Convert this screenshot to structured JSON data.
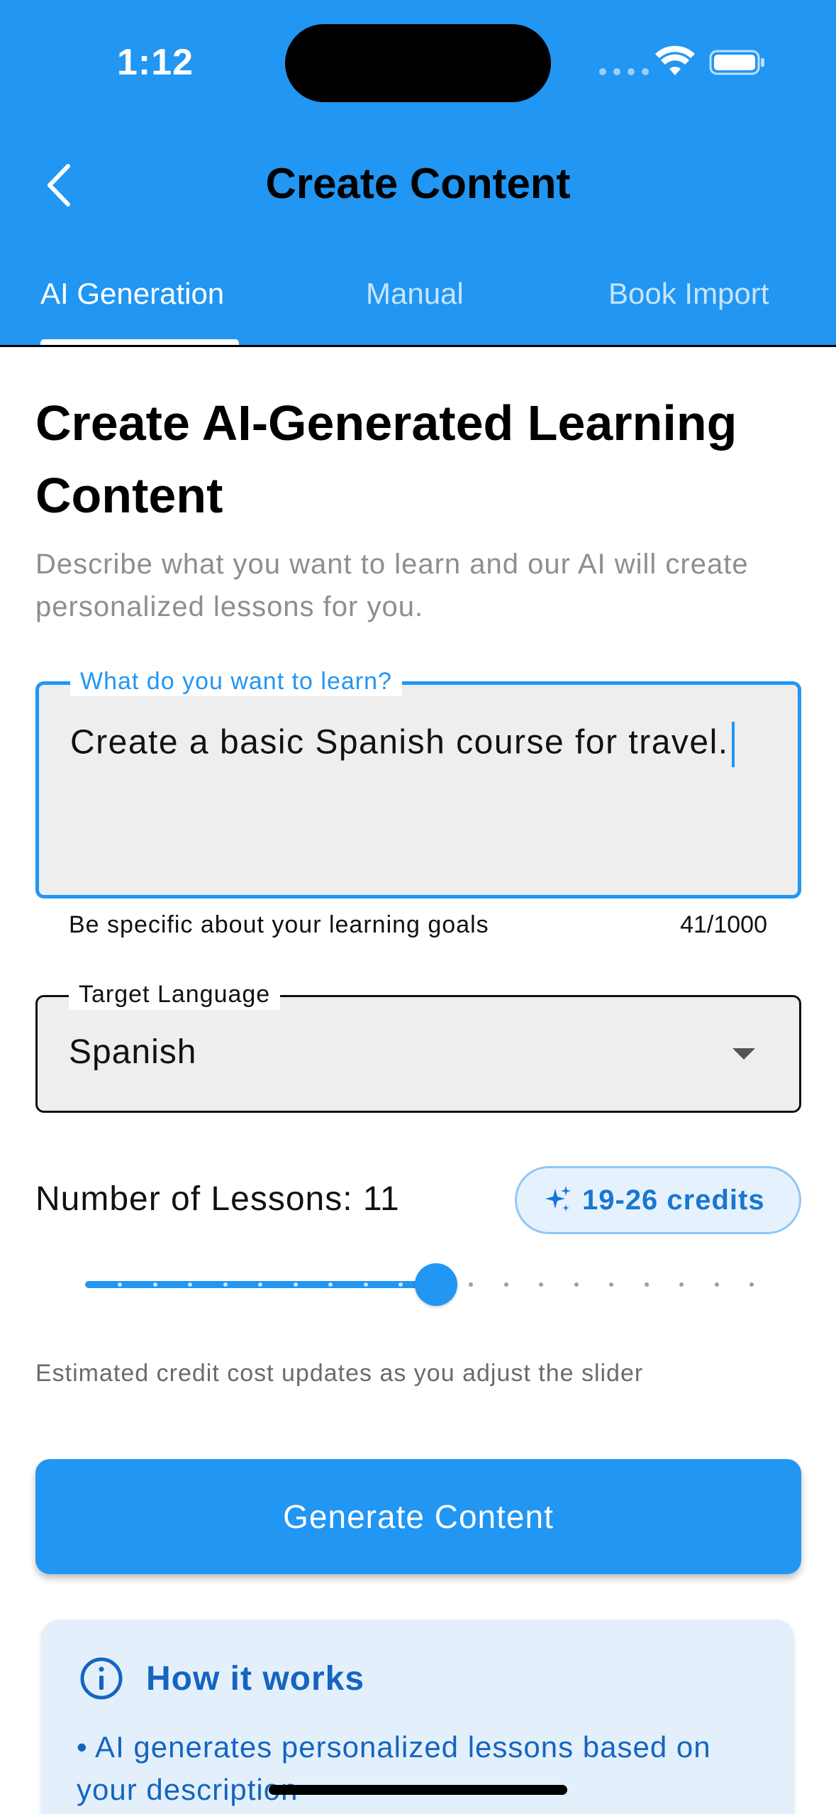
{
  "status_bar": {
    "time": "1:12"
  },
  "header": {
    "title": "Create Content",
    "tabs": [
      {
        "label": "AI Generation",
        "active": true
      },
      {
        "label": "Manual",
        "active": false
      },
      {
        "label": "Book Import",
        "active": false
      }
    ]
  },
  "main": {
    "title": "Create AI-Generated Learning Content",
    "description": "Describe what you want to learn and our AI will create personalized lessons for you.",
    "learn_field": {
      "label": "What do you want to learn?",
      "value": "Create a basic Spanish course for travel.",
      "helper": "Be specific about your learning goals",
      "counter": "41/1000"
    },
    "language_field": {
      "label": "Target Language",
      "value": "Spanish"
    },
    "lessons": {
      "label": "Number of Lessons: 11",
      "value": 11,
      "min": 1,
      "max": 20,
      "credits": "19-26 credits",
      "note": "Estimated credit cost updates as you adjust the slider"
    },
    "generate_label": "Generate Content",
    "info": {
      "title": "How it works",
      "bullet": "• AI generates personalized lessons based on your description"
    }
  },
  "colors": {
    "primary": "#2196F3",
    "primary_dark": "#1565C0",
    "info_bg": "#e3f0fb",
    "field_bg": "#eeeeee"
  },
  "icons": [
    "back-arrow-icon",
    "wifi-icon",
    "battery-icon",
    "chevron-down-icon",
    "sparkle-icon",
    "info-icon"
  ]
}
